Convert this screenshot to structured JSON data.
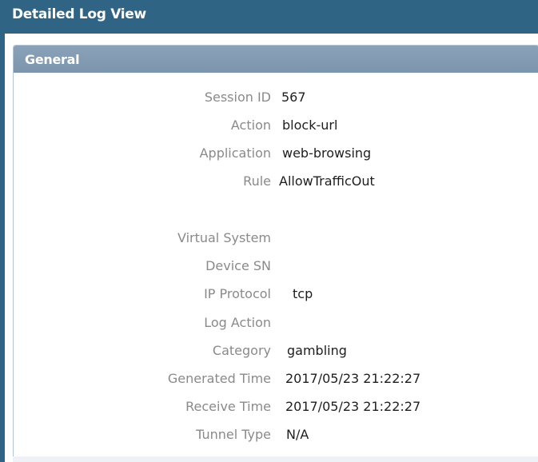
{
  "window": {
    "title": "Detailed Log View"
  },
  "panel": {
    "title": "General"
  },
  "fields": [
    {
      "label": "Session ID",
      "value": "567"
    },
    {
      "label": "Action",
      "value": "block-url"
    },
    {
      "label": "Application",
      "value": "web-browsing"
    },
    {
      "label": "Rule",
      "value": "AllowTrafficOut"
    },
    {
      "label": "Virtual System",
      "value": ""
    },
    {
      "label": "Device SN",
      "value": ""
    },
    {
      "label": "IP Protocol",
      "value": "tcp"
    },
    {
      "label": "Log Action",
      "value": ""
    },
    {
      "label": "Category",
      "value": "gambling"
    },
    {
      "label": "Generated Time",
      "value": "2017/05/23 21:22:27"
    },
    {
      "label": "Receive Time",
      "value": "2017/05/23 21:22:27"
    },
    {
      "label": "Tunnel Type",
      "value": "N/A"
    }
  ],
  "colors": {
    "window_bg": "#2f6485",
    "panel_header": "#7f99b0",
    "label_text": "#8a8a8a",
    "value_text": "#1e1e1e"
  }
}
